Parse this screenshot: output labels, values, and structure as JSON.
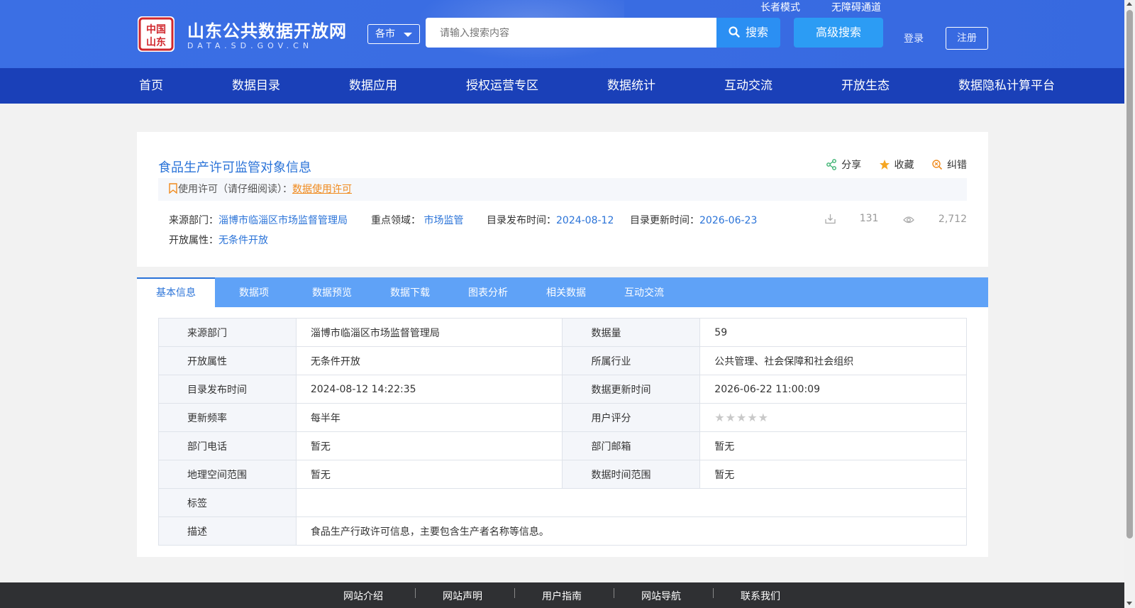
{
  "header": {
    "site_title": "山东公共数据开放网",
    "site_sub": "DATA.SD.GOV.CN",
    "city_select": "各市",
    "search_placeholder": "请输入搜索内容",
    "search_button": "搜索",
    "advanced_search": "高级搜索",
    "elder_mode": "长者模式",
    "accessibility": "无障碍通道",
    "login": "登录",
    "register": "注册"
  },
  "nav": [
    "首页",
    "数据目录",
    "数据应用",
    "授权运营专区",
    "数据统计",
    "互动交流",
    "开放生态",
    "数据隐私计算平台"
  ],
  "dataset": {
    "title": "食品生产许可监管对象信息",
    "share": "分享",
    "favorite": "收藏",
    "report": "纠错",
    "license_label": "使用许可（请仔细阅读）：",
    "license_link": "数据使用许可",
    "source_label": "来源部门：",
    "source_value": "淄博市临淄区市场监督管理局",
    "domain_label": "重点领域：",
    "domain_value": "市场监管",
    "publish_label": "目录发布时间：",
    "publish_value": "2024-08-12",
    "update_label": "目录更新时间：",
    "update_value": "2026-06-23",
    "open_label": "开放属性：",
    "open_value": "无条件开放",
    "downloads": "131",
    "views": "2,712"
  },
  "tabs": [
    "基本信息",
    "数据项",
    "数据预览",
    "数据下载",
    "图表分析",
    "相关数据",
    "互动交流"
  ],
  "info_table": {
    "rows": [
      [
        "来源部门",
        "淄博市临淄区市场监督管理局",
        "数据量",
        "59"
      ],
      [
        "开放属性",
        "无条件开放",
        "所属行业",
        "公共管理、社会保障和社会组织"
      ],
      [
        "目录发布时间",
        "2024-08-12 14:22:35",
        "数据更新时间",
        "2026-06-22 11:00:09"
      ],
      [
        "更新频率",
        "每半年",
        "用户评分",
        ""
      ],
      [
        "部门电话",
        "暂无",
        "部门邮箱",
        "暂无"
      ],
      [
        "地理空间范围",
        "暂无",
        "数据时间范围",
        "暂无"
      ]
    ],
    "tags_label": "标签",
    "tags_value": "",
    "desc_label": "描述",
    "desc_value": "食品生产行政许可信息，主要包含生产者名称等信息。",
    "rating": 0
  },
  "footer": [
    "网站介绍",
    "网站声明",
    "用户指南",
    "网站导航",
    "联系我们"
  ],
  "colors": {
    "header_blue": "#3b6fe4",
    "nav_blue": "#1a40b8",
    "link_blue": "#2a73d8",
    "tab_blue": "#5fa2f7",
    "license_orange": "#f08a1d"
  }
}
